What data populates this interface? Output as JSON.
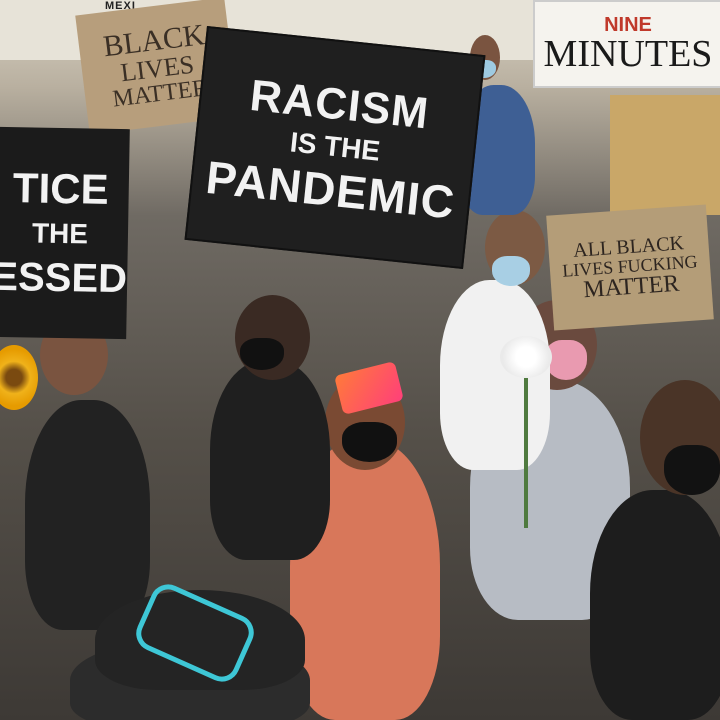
{
  "image": {
    "description_hidden": false
  },
  "background": {
    "storefront_text": "MEXI"
  },
  "signs": {
    "racism": {
      "line1": "RACISM",
      "line2": "IS THE",
      "line3": "PANDEMIC"
    },
    "justice": {
      "line1": "TICE",
      "line2": "THE",
      "line3": "ESSED"
    },
    "blm": {
      "line1": "BLACK",
      "line2": "LIVES",
      "line3": "MATTER"
    },
    "nine_minutes": {
      "line0": "NINE",
      "line1": "MINUTES"
    },
    "all_black_lives": {
      "line1": "ALL BLACK",
      "line2": "LIVES FUCKING",
      "line3": "MATTER"
    }
  },
  "colors": {
    "sign_black": "#1f1f1f",
    "cardboard": "#b79e7c",
    "phone_pink": "#ff5a5a",
    "sunglasses_teal": "#3ec7d6"
  }
}
